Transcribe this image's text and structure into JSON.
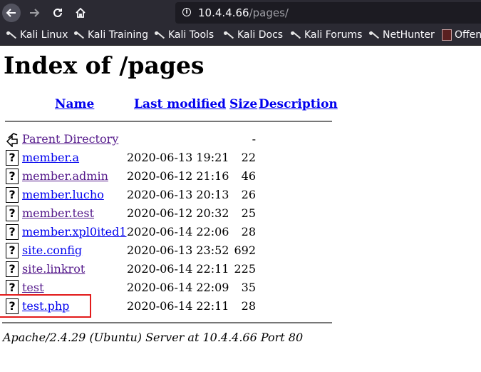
{
  "browser": {
    "url_host": "10.4.4.66",
    "url_path": "/pages/",
    "bookmarks": [
      "Kali Linux",
      "Kali Training",
      "Kali Tools",
      "Kali Docs",
      "Kali Forums",
      "NetHunter",
      "Offen"
    ]
  },
  "page": {
    "title": "Index of /pages",
    "columns": {
      "name": "Name",
      "modified": "Last modified",
      "size": "Size",
      "description": "Description"
    },
    "parent": {
      "name": "Parent Directory",
      "size": "-"
    },
    "files": [
      {
        "name": "member.a",
        "modified": "2020-06-13 19:21",
        "size": "22",
        "visited": false
      },
      {
        "name": "member.admin",
        "modified": "2020-06-12 21:16",
        "size": "46",
        "visited": true
      },
      {
        "name": "member.lucho",
        "modified": "2020-06-13 20:13",
        "size": "26",
        "visited": false
      },
      {
        "name": "member.test",
        "modified": "2020-06-12 20:32",
        "size": "25",
        "visited": true
      },
      {
        "name": "member.xpl0ited1",
        "modified": "2020-06-14 22:06",
        "size": "28",
        "visited": false
      },
      {
        "name": "site.config",
        "modified": "2020-06-13 23:52",
        "size": "692",
        "visited": false
      },
      {
        "name": "site.linkrot",
        "modified": "2020-06-14 22:11",
        "size": "225",
        "visited": true
      },
      {
        "name": "test",
        "modified": "2020-06-14 22:09",
        "size": "35",
        "visited": true
      },
      {
        "name": "test.php",
        "modified": "2020-06-14 22:11",
        "size": "28",
        "visited": false
      }
    ],
    "footer": "Apache/2.4.29 (Ubuntu) Server at 10.4.4.66 Port 80"
  },
  "colors": {
    "link": "#0000ee",
    "visited": "#551a8b",
    "highlight": "#e21b1b",
    "chrome": "#2b2a33"
  }
}
